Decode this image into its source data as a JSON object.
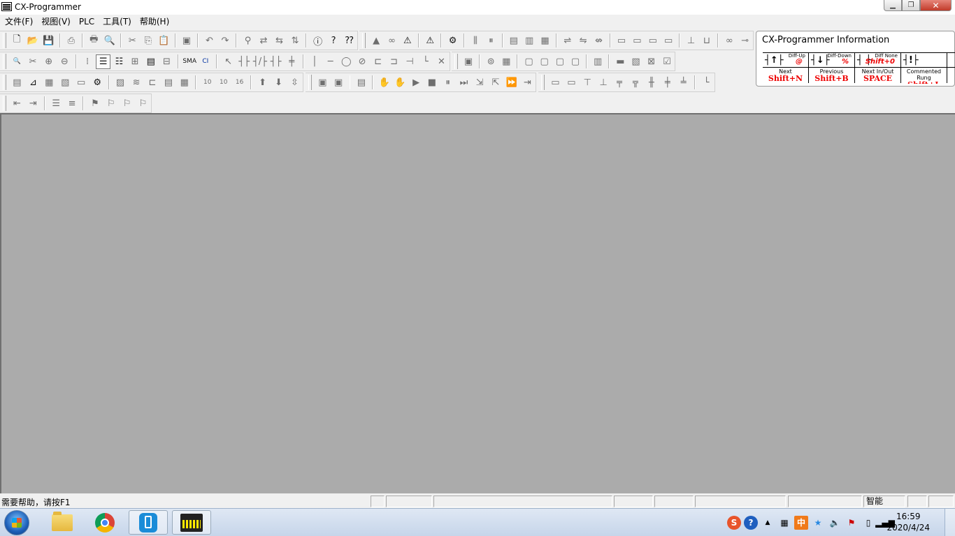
{
  "window": {
    "title": "CX-Programmer"
  },
  "menu": [
    "文件(F)",
    "视图(V)",
    "PLC",
    "工具(T)",
    "帮助(H)"
  ],
  "info_panel": {
    "title": "CX-Programmer Information",
    "top_cells": [
      {
        "symbol": "┤↑├",
        "tiny": "Diff-Up",
        "key": "@"
      },
      {
        "symbol": "┤↓├",
        "tiny": "Diff-Down",
        "key": "%"
      },
      {
        "symbol": "┤ ├",
        "tiny": "Diff None",
        "key": "Shift+0"
      },
      {
        "symbol": "┤!├",
        "tiny": "",
        "key": ""
      }
    ],
    "bottom_cells": [
      {
        "label": "Next",
        "key": "Shift+N"
      },
      {
        "label": "Previous",
        "key": "Shift+B"
      },
      {
        "label": "Next In/Out",
        "key": "SPACE"
      },
      {
        "label": "Commented Rung",
        "key": "Shift+L"
      }
    ]
  },
  "status": {
    "help_text": "需要帮助，请按F1",
    "mode": "智能"
  },
  "tray": {
    "ime": "中",
    "time": "16:59",
    "date": "2020/4/24"
  },
  "toolbar_icons": {
    "row1": [
      "new",
      "open",
      "save",
      "sep",
      "preview",
      "sep",
      "print",
      "print-preview",
      "sep",
      "cut",
      "copy",
      "paste",
      "sep",
      "paste-special",
      "sep",
      "undo",
      "redo",
      "sep",
      "find",
      "replace",
      "replace-all",
      "find-address",
      "sep",
      "about",
      "help",
      "context-help"
    ],
    "row1b": [
      "bell",
      "binocular",
      "warning-find",
      "sep",
      "project-check",
      "sep",
      "compile",
      "pause",
      "sep",
      "io-table",
      "memory",
      "mem-setup",
      "sep",
      "online1",
      "online2",
      "online3",
      "sep",
      "transfer1",
      "transfer2",
      "transfer3",
      "transfer4",
      "sep",
      "io1",
      "io2",
      "sep",
      "link1",
      "link2"
    ]
  }
}
